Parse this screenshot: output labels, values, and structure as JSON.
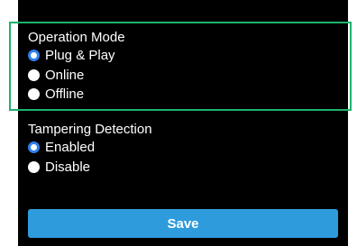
{
  "operation_mode": {
    "title": "Operation Mode",
    "options": [
      {
        "label": "Plug & Play",
        "checked": true
      },
      {
        "label": "Online",
        "checked": false
      },
      {
        "label": "Offline",
        "checked": false
      }
    ]
  },
  "tampering_detection": {
    "title": "Tampering Detection",
    "options": [
      {
        "label": "Enabled",
        "checked": true
      },
      {
        "label": "Disable",
        "checked": false
      }
    ]
  },
  "actions": {
    "save_label": "Save"
  },
  "colors": {
    "background": "#000000",
    "accent": "#2F80ED",
    "button": "#2E9BDC",
    "highlight": "#1DB36B"
  }
}
